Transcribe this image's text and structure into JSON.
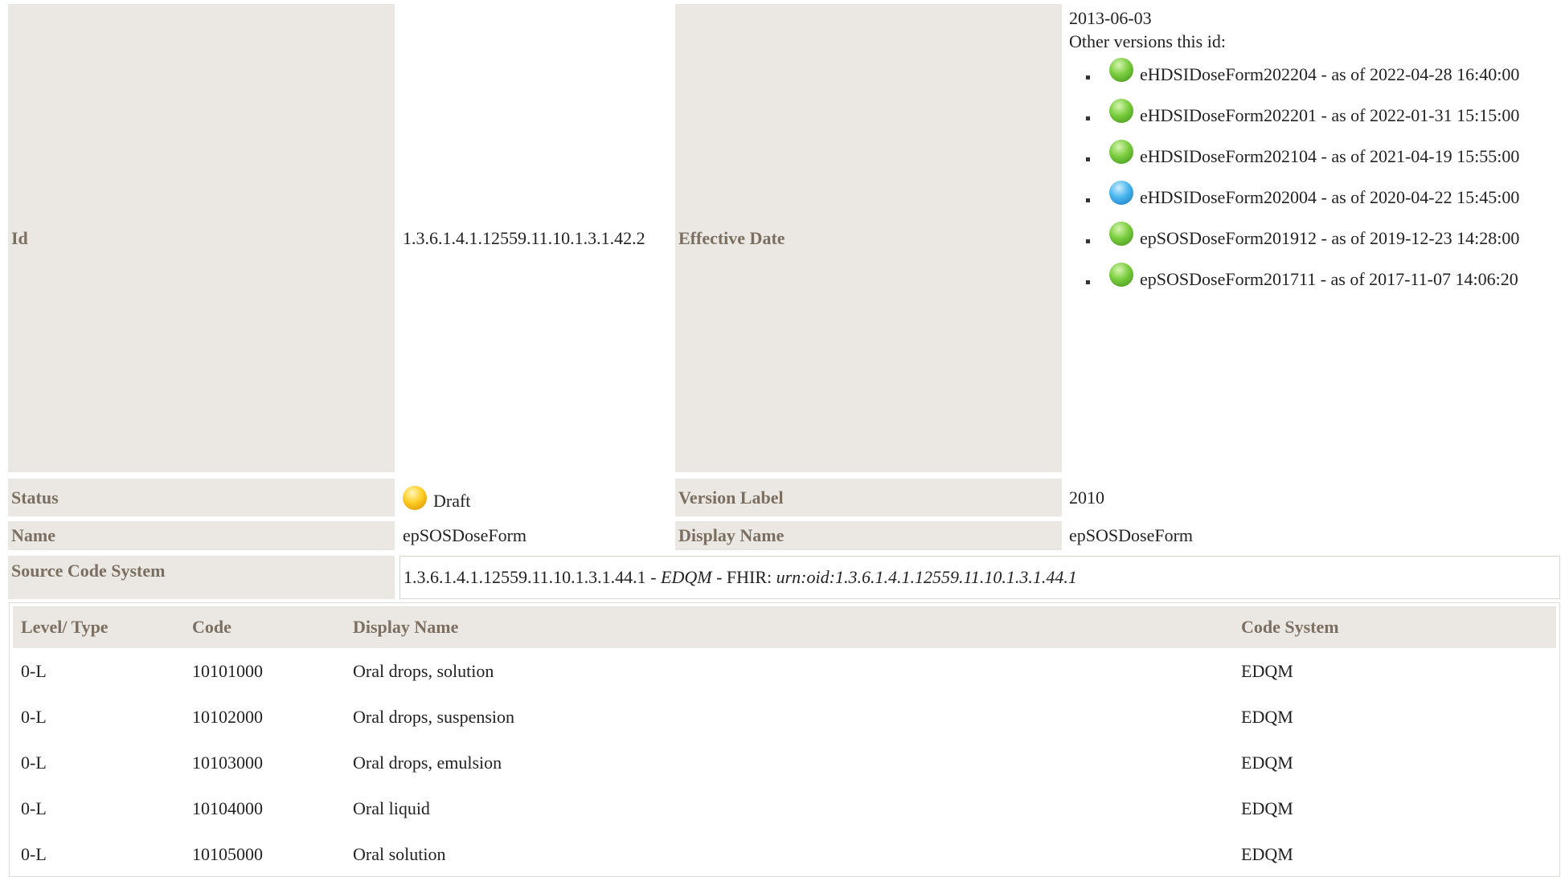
{
  "fields": {
    "id_label": "Id",
    "id_value": "1.3.6.1.4.1.12559.11.10.1.3.1.42.2",
    "effective_date_label": "Effective Date",
    "effective_date_value": "2013-06-03",
    "other_versions_label": "Other versions this id:",
    "status_label": "Status",
    "status_value": "Draft",
    "version_label_label": "Version Label",
    "version_label_value": "2010",
    "name_label": "Name",
    "name_value": "epSOSDoseForm",
    "display_name_label": "Display Name",
    "display_name_value": "epSOSDoseForm",
    "source_code_system_label": "Source Code System",
    "source_oid": "1.3.6.1.4.1.12559.11.10.1.3.1.44.1",
    "source_sep1": " - ",
    "source_name": "EDQM",
    "source_sep2": " - FHIR: ",
    "source_fhir": "urn:oid:1.3.6.1.4.1.12559.11.10.1.3.1.44.1"
  },
  "versions": [
    {
      "text": "eHDSIDoseForm202204 - as of 2022-04-28 16:40:00",
      "status_color": "#79cd3d"
    },
    {
      "text": "eHDSIDoseForm202201 - as of 2022-01-31 15:15:00",
      "status_color": "#79cd3d"
    },
    {
      "text": "eHDSIDoseForm202104 - as of 2021-04-19 15:55:00",
      "status_color": "#79cd3d"
    },
    {
      "text": "eHDSIDoseForm202004 - as of 2020-04-22 15:45:00",
      "status_color": "#46b5ef"
    },
    {
      "text": "epSOSDoseForm201912 - as of 2019-12-23 14:28:00",
      "status_color": "#79cd3d"
    },
    {
      "text": "epSOSDoseForm201711 - as of 2017-11-07 14:06:20",
      "status_color": "#79cd3d"
    }
  ],
  "table": {
    "headers": [
      "Level/ Type",
      "Code",
      "Display Name",
      "Code System"
    ],
    "rows": [
      [
        "0-L",
        "10101000",
        "Oral drops, solution",
        "EDQM"
      ],
      [
        "0-L",
        "10102000",
        "Oral drops, suspension",
        "EDQM"
      ],
      [
        "0-L",
        "10103000",
        "Oral drops, emulsion",
        "EDQM"
      ],
      [
        "0-L",
        "10104000",
        "Oral liquid",
        "EDQM"
      ],
      [
        "0-L",
        "10105000",
        "Oral solution",
        "EDQM"
      ]
    ]
  },
  "colors": {
    "label_bg": "#ebe8e3",
    "label_text": "#7b6f62"
  }
}
